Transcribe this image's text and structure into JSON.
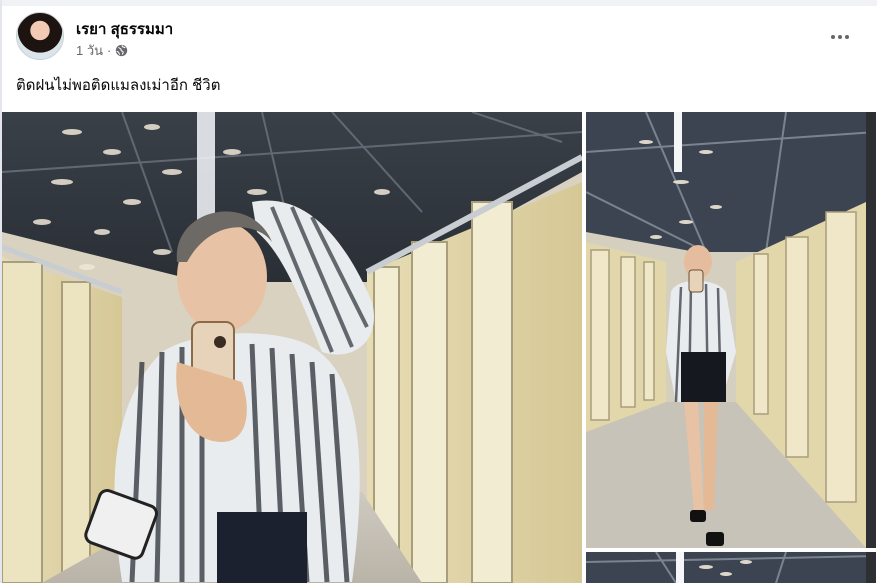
{
  "post": {
    "author": "เรยา สุธรรมมา",
    "time": "1 วัน",
    "separator": "·",
    "privacy_icon": "globe-icon",
    "more_icon": "more-horizontal-icon",
    "text": "ติดฝนไม่พอติดแมลงเม่าอีก ชีวิต"
  },
  "colors": {
    "meta_text": "#65676b",
    "divider": "#f0f2f5"
  }
}
